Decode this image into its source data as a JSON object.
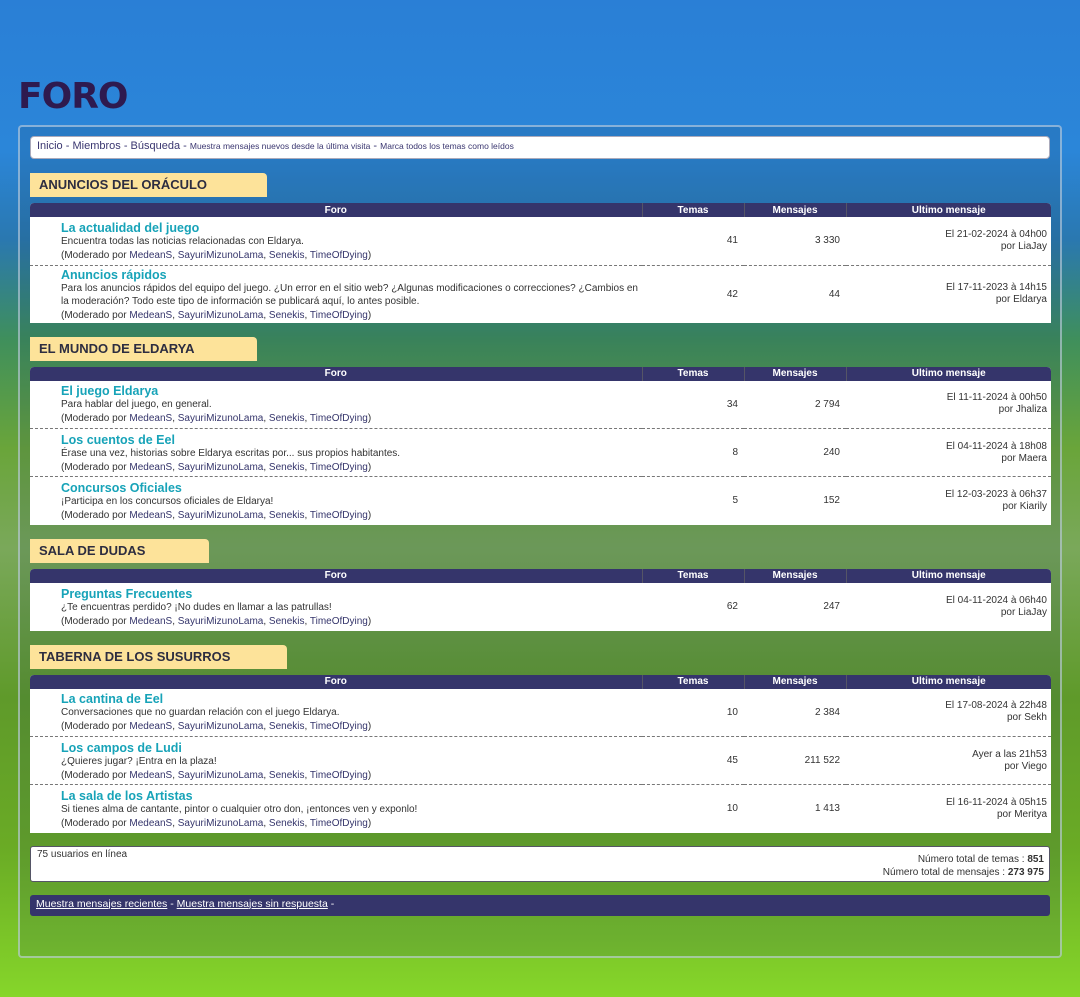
{
  "title": "FORO",
  "nav": {
    "inicio": "Inicio",
    "miembros": "Miembros",
    "busqueda": "Búsqueda",
    "nuevos": "Muestra mensajes nuevos desde la última visita",
    "marcar": "Marca todos los temas como leídos",
    "sep": " - "
  },
  "headers": {
    "foro": "Foro",
    "temas": "Temas",
    "mensajes": "Mensajes",
    "ultimo": "Ultimo mensaje"
  },
  "mod_prefix": "(Moderado por ",
  "moderators": [
    "MedeanS",
    "SayuriMizunoLama",
    "Senekis",
    "TimeOfDying"
  ],
  "categories": [
    {
      "name": "ANUNCIOS DEL ORÁCULO",
      "forums": [
        {
          "name": "La actualidad del juego",
          "desc": "Encuentra todas las noticias relacionadas con Eldarya.",
          "temas": "41",
          "mensajes": "3 330",
          "last_date": "El 21-02-2024 à 04h00",
          "last_by": "por LiaJay"
        },
        {
          "name": "Anuncios rápidos",
          "desc": "Para los anuncios rápidos del equipo del juego. ¿Un error en el sitio web? ¿Algunas modificaciones o correcciones? ¿Cambios en la moderación? Todo este tipo de información se publicará aquí, lo antes posible.",
          "temas": "42",
          "mensajes": "44",
          "last_date": "El 17-11-2023 à 14h15",
          "last_by": "por Eldarya"
        }
      ]
    },
    {
      "name": "EL MUNDO DE ELDARYA",
      "forums": [
        {
          "name": "El juego Eldarya",
          "desc": "Para hablar del juego, en general.",
          "temas": "34",
          "mensajes": "2 794",
          "last_date": "El 11-11-2024 à 00h50",
          "last_by": "por Jhaliza"
        },
        {
          "name": "Los cuentos de Eel",
          "desc": "Érase una vez, historias sobre Eldarya escritas por... sus propios habitantes.",
          "temas": "8",
          "mensajes": "240",
          "last_date": "El 04-11-2024 à 18h08",
          "last_by": "por Maera"
        },
        {
          "name": "Concursos Oficiales",
          "desc": "¡Participa en los concursos oficiales de Eldarya!",
          "temas": "5",
          "mensajes": "152",
          "last_date": "El 12-03-2023 à 06h37",
          "last_by": "por Kiarily"
        }
      ]
    },
    {
      "name": "SALA DE DUDAS",
      "forums": [
        {
          "name": "Preguntas Frecuentes",
          "desc": "¿Te encuentras perdido? ¡No dudes en llamar a las patrullas!",
          "temas": "62",
          "mensajes": "247",
          "last_date": "El 04-11-2024 à 06h40",
          "last_by": "por LiaJay"
        }
      ]
    },
    {
      "name": "TABERNA DE LOS SUSURROS",
      "forums": [
        {
          "name": "La cantina de Eel",
          "desc": "Conversaciones que no guardan relación con el juego Eldarya.",
          "temas": "10",
          "mensajes": "2 384",
          "last_date": "El 17-08-2024 à 22h48",
          "last_by": "por Sekh"
        },
        {
          "name": "Los campos de Ludi",
          "desc": "¿Quieres jugar? ¡Entra en la plaza!",
          "temas": "45",
          "mensajes": "211 522",
          "last_date": "Ayer a las 21h53",
          "last_by": "por Viego"
        },
        {
          "name": "La sala de los Artistas",
          "desc": "Si tienes alma de cantante, pintor o cualquier otro don, ¡entonces ven y exponlo!",
          "temas": "10",
          "mensajes": "1 413",
          "last_date": "El 16-11-2024 à 05h15",
          "last_by": "por Meritya"
        }
      ]
    }
  ],
  "stats": {
    "online": "75 usuarios en línea",
    "temas_label": "Número total de temas : ",
    "temas": "851",
    "mensajes_label": "Número total de mensajes : ",
    "mensajes": "273 975"
  },
  "footer": {
    "recientes": "Muestra mensajes recientes",
    "sin_respuesta": "Muestra mensajes sin respuesta",
    "sep": " - "
  }
}
